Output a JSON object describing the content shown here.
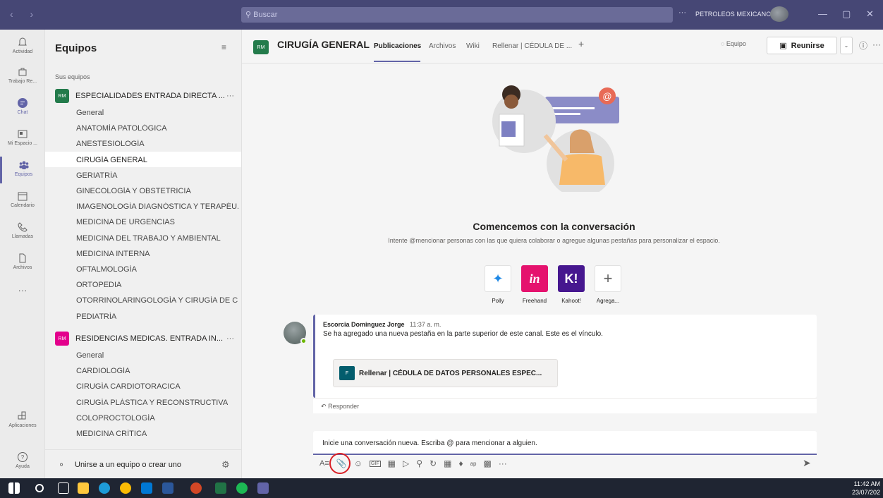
{
  "titlebar": {
    "search_placeholder": "Buscar",
    "org_name": "PETROLEOS MEXICANOS"
  },
  "rail": {
    "items": [
      {
        "label": "Actividad",
        "icon": "bell-icon"
      },
      {
        "label": "Trabajo Re...",
        "icon": "briefcase-icon"
      },
      {
        "label": "Chat",
        "icon": "chat-icon"
      },
      {
        "label": "Mi Espacio ...",
        "icon": "workspace-icon"
      },
      {
        "label": "Equipos",
        "icon": "teams-icon"
      },
      {
        "label": "Calendario",
        "icon": "calendar-icon"
      },
      {
        "label": "Llamadas",
        "icon": "phone-icon"
      },
      {
        "label": "Archivos",
        "icon": "file-icon"
      }
    ],
    "apps_label": "Aplicaciones",
    "help_label": "Ayuda"
  },
  "teams_panel": {
    "title": "Equipos",
    "section_label": "Sus equipos",
    "team1": {
      "badge": "RM",
      "name": "ESPECIALIDADES ENTRADA DIRECTA ...",
      "channels": [
        "General",
        "ANATOMÍA PATOLÓGICA",
        "ANESTESIOLOGÍA",
        "CIRUGÍA GENERAL",
        "GERIATRÍA",
        "GINECOLOGÍA Y OBSTETRICIA",
        "IMAGENOLOGÍA DIAGNÓSTICA Y TERAPÉU...",
        "MEDICINA DE URGENCIAS",
        "MEDICINA DEL TRABAJO Y AMBIENTAL",
        "MEDICINA INTERNA",
        "OFTALMOLOGÍA",
        "ORTOPEDIA",
        "OTORRINOLARINGOLOGÍA Y CIRUGÍA DE C...",
        "PEDIATRÍA"
      ]
    },
    "team2": {
      "badge": "RM",
      "name": "RESIDENCIAS MEDICAS. ENTRADA IN...",
      "channels": [
        "General",
        "CARDIOLOGÍA",
        "CIRUGÍA CARDIOTORACICA",
        "CIRUGÍA PLÁSTICA Y RECONSTRUCTIVA",
        "COLOPROCTOLOGÍA",
        "MEDICINA CRÍTICA"
      ]
    },
    "footer_label": "Unirse a un equipo o crear uno"
  },
  "header": {
    "badge": "RM",
    "title": "CIRUGÍA GENERAL",
    "tabs": [
      "Publicaciones",
      "Archivos",
      "Wiki",
      "Rellenar | CÉDULA DE ..."
    ],
    "team_button": "Equipo",
    "meet_button": "Reunirse"
  },
  "welcome": {
    "title": "Comencemos con la conversación",
    "subtitle": "Intente @mencionar personas con las que quiera colaborar o agregue algunas pestañas para personalizar el espacio."
  },
  "apps": [
    {
      "label": "Polly",
      "color": "#ffffff"
    },
    {
      "label": "Freehand",
      "color": "#e5136e"
    },
    {
      "label": "Kahoot!",
      "color": "#46178f"
    },
    {
      "label": "Agrega...",
      "color": "#ffffff"
    }
  ],
  "post": {
    "author": "Escorcia Dominguez Jorge",
    "time": "11:37 a. m.",
    "body": "Se ha agregado una nueva pestaña en la parte superior de este canal. Este es el vínculo.",
    "card_label": "Rellenar | CÉDULA DE DATOS PERSONALES ESPEC...",
    "reply_label": "Responder"
  },
  "compose": {
    "placeholder": "Inicie una conversación nueva. Escriba @ para mencionar a alguien."
  },
  "taskbar": {
    "time": "11:42 AM",
    "date": "23/07/202"
  },
  "colors": {
    "accent": "#6264a7",
    "titlebar": "#464775",
    "highlight": "#d91f26"
  }
}
